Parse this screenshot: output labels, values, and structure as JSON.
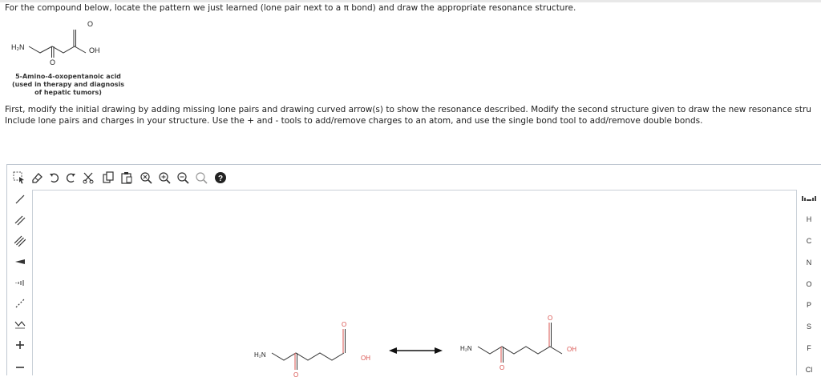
{
  "question": {
    "prompt": "For the compound below, locate the pattern we just learned (lone pair next to a π bond) and draw the appropriate resonance structure.",
    "molecule": {
      "amine_label": "H₂N",
      "hydroxyl_label": "OH",
      "oxygen_label": "O",
      "name_line1": "5-Amino-4-oxopentanoic acid",
      "name_line2": "(used in therapy and diagnosis",
      "name_line3": "of hepatic tumors)"
    },
    "instruction_line1": "First, modify the initial drawing by adding missing lone pairs and drawing curved arrow(s) to show the resonance described. Modify the second structure given to draw the new resonance stru",
    "instruction_line2": "Include lone pairs and charges in your structure. Use the + and - tools to add/remove charges to an atom, and use the single bond tool to add/remove double bonds."
  },
  "editor": {
    "toolbar": [
      "select-tool",
      "erase-tool",
      "undo",
      "redo",
      "cut",
      "copy",
      "paste",
      "zoom-fit",
      "zoom-in",
      "zoom-out",
      "zoom-reset",
      "help"
    ],
    "left_tools": [
      "single-bond",
      "double-bond",
      "triple-bond",
      "wedge-bond",
      "hash-bond",
      "curved-arrow",
      "chain",
      "plus-charge",
      "minus-charge"
    ],
    "elements": [
      "H",
      "C",
      "N",
      "O",
      "P",
      "S",
      "F",
      "Cl"
    ],
    "canvas": {
      "left_amine": "H₂N",
      "left_hydroxyl": "OH",
      "left_oxygen": "O",
      "right_amine": "H₂N",
      "right_hydroxyl": "OH",
      "right_oxygen": "O"
    }
  }
}
